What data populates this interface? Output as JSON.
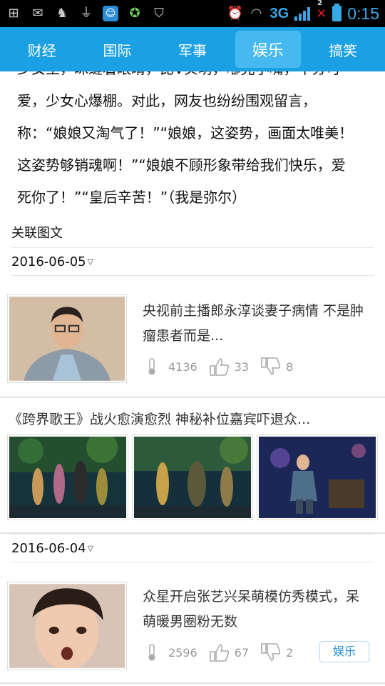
{
  "status_bar": {
    "icons": [
      "add-icon",
      "mail-check-icon",
      "android-icon",
      "usb-icon",
      "qq-icon",
      "wechat-icon",
      "security-check-icon"
    ],
    "right_icons": [
      "alarm-icon",
      "wifi-icon"
    ],
    "network": "3G",
    "sim_badge": "2",
    "time": "0:15"
  },
  "tabs": [
    {
      "label": "财经",
      "active": false
    },
    {
      "label": "国际",
      "active": false
    },
    {
      "label": "军事",
      "active": false
    },
    {
      "label": "娱乐",
      "active": true
    },
    {
      "label": "搞笑",
      "active": false
    }
  ],
  "article": {
    "cut_line": "少女王，眯缝着眼睛，比V实萌，嘟兜小嘴，十分可",
    "lines": [
      "爱，少女心爆棚。对此，网友也纷纷围观留言，",
      "称：“娘娘又淘气了！”“娘娘，这姿势，画面太唯美！",
      "这姿势够销魂啊！”“娘娘不顾形象带给我们快乐，爱",
      "死你了！”“皇后辛苦！”（我是弥尔）"
    ]
  },
  "related": {
    "title": "关联图文",
    "groups": [
      {
        "date": "2016-06-05",
        "news": {
          "title": "央视前主播郎永淳谈妻子病情 不是肿瘤患者而是...",
          "views": "4136",
          "likes": "33",
          "dislikes": "8"
        },
        "gallery": {
          "title": "《跨界歌王》战火愈演愈烈 神秘补位嘉宾吓退众..."
        }
      },
      {
        "date": "2016-06-04",
        "news": {
          "title": "众星开启张艺兴呆萌模仿秀模式，呆萌暖男圈粉无数",
          "views": "2596",
          "likes": "67",
          "dislikes": "2",
          "tag": "娱乐"
        }
      }
    ]
  },
  "colors": {
    "tab_bar": "#1aa0e3",
    "tab_active": "#46b9f0",
    "status_accent": "#37a8e8",
    "tag_text": "#2a8fd0"
  }
}
